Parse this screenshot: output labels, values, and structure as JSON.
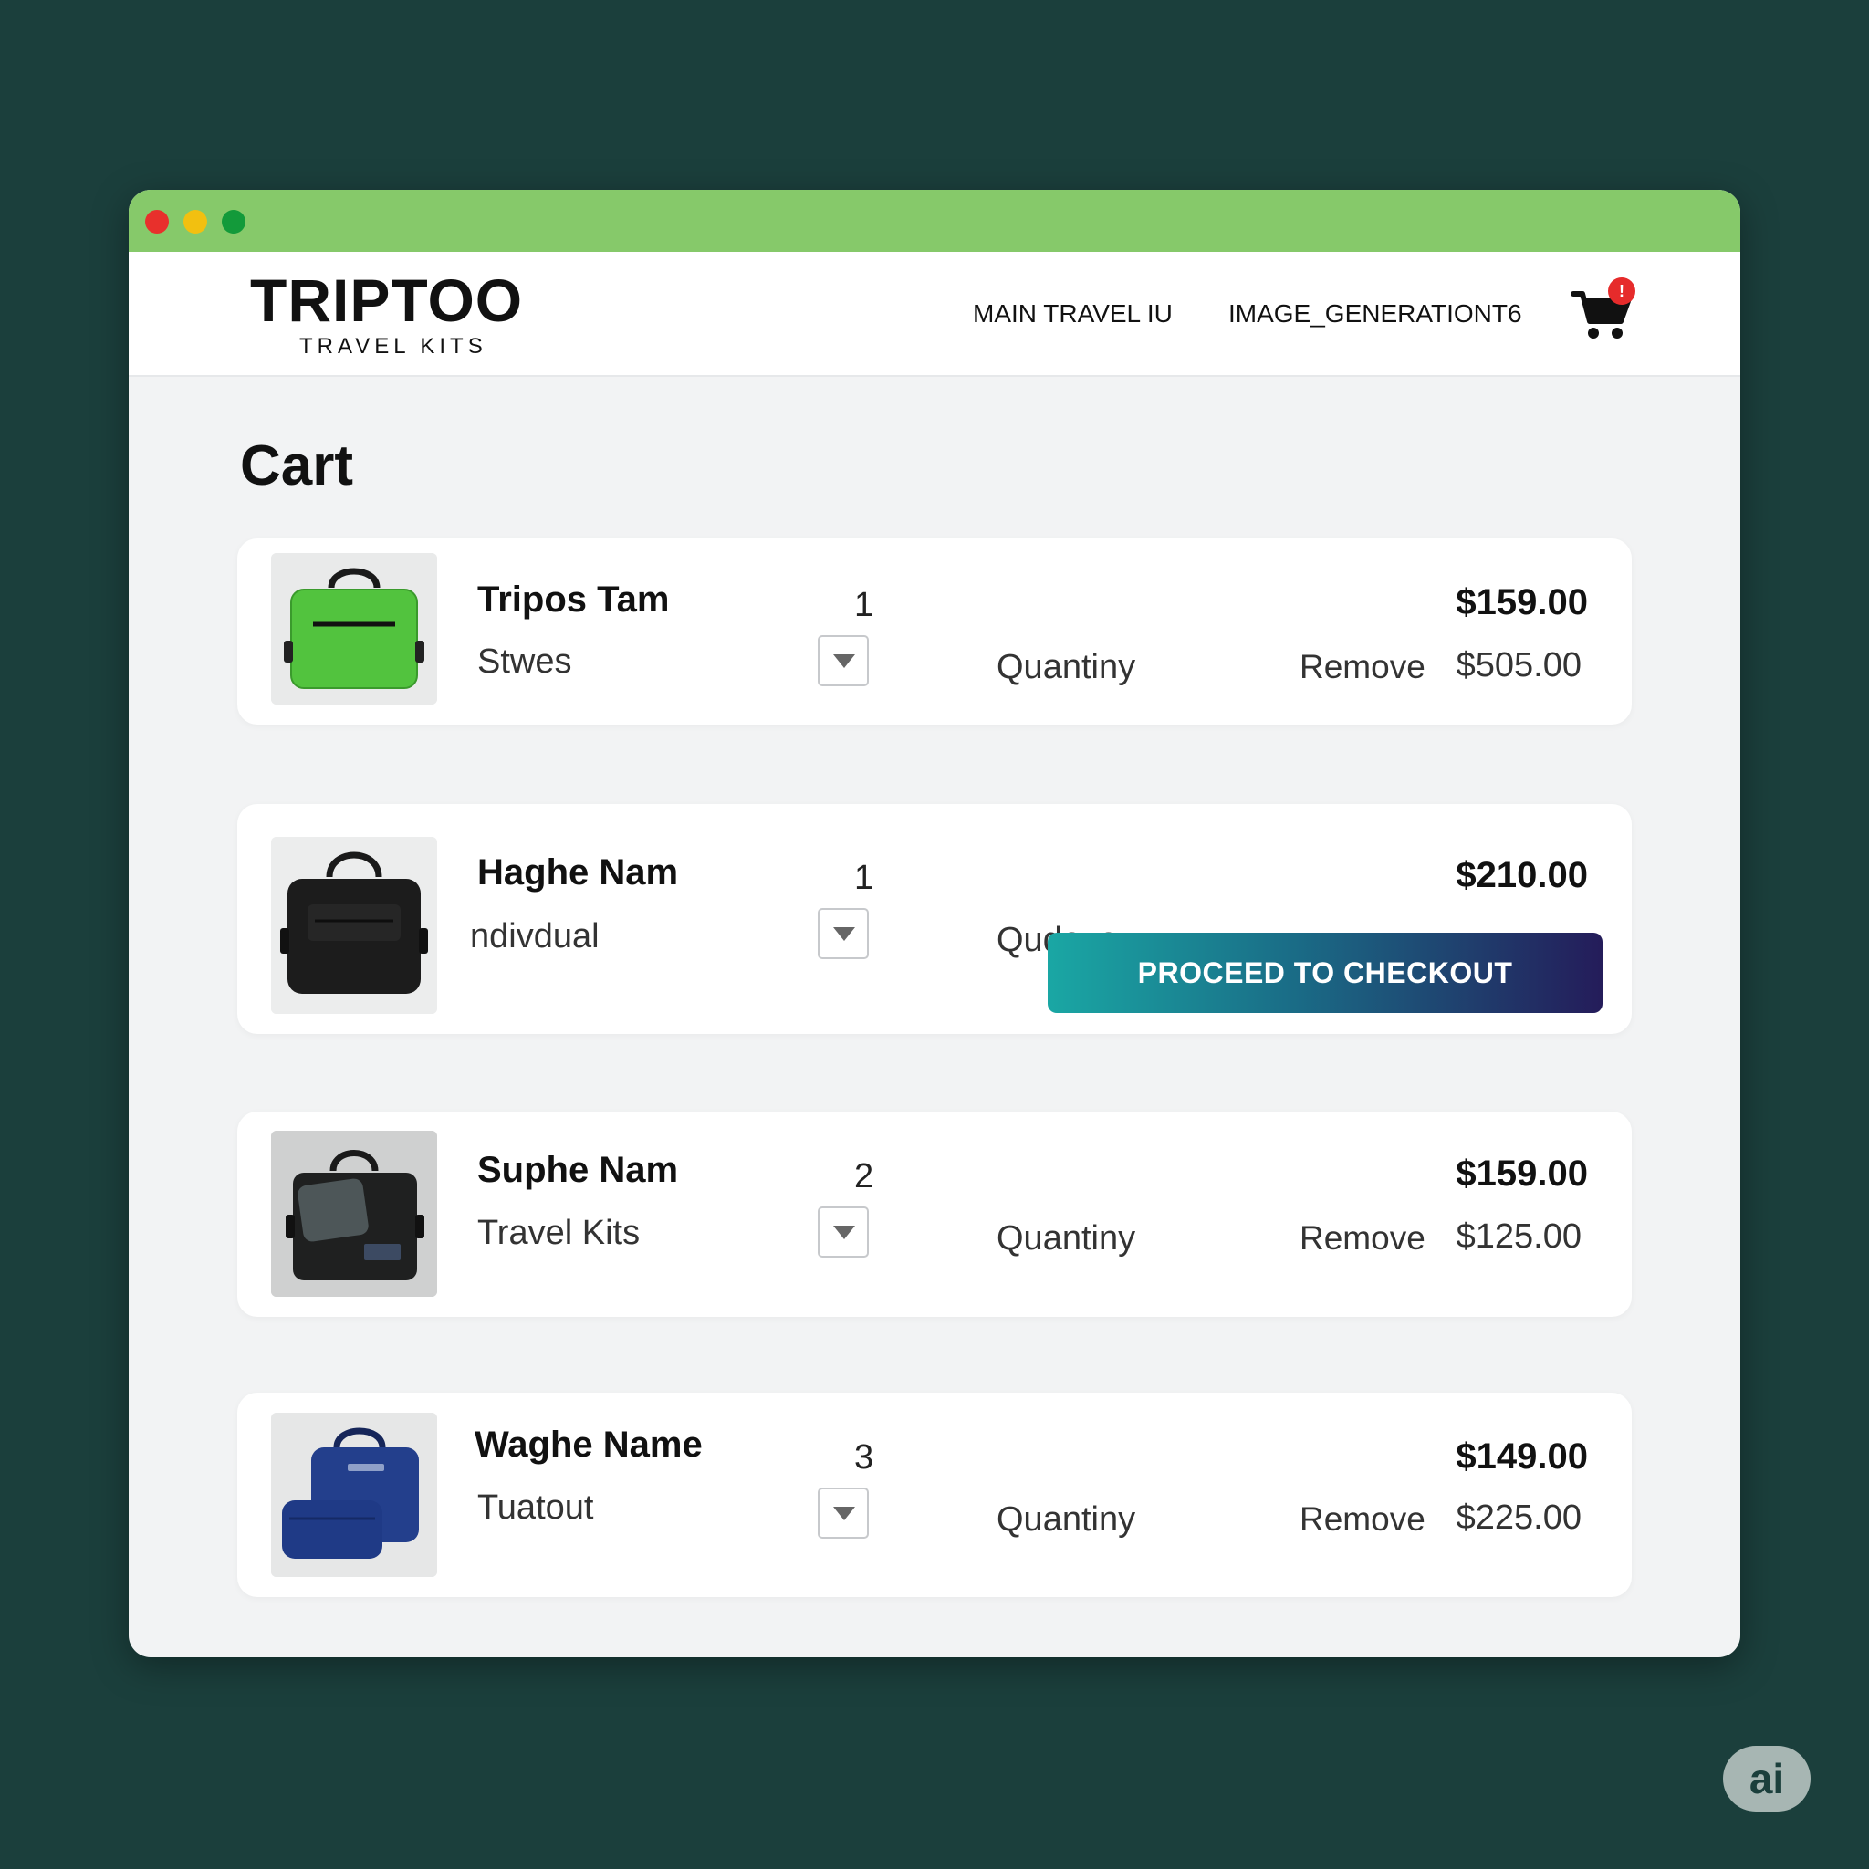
{
  "brand": {
    "name": "TRIPTOO",
    "tagline": "TRAVEL KITS"
  },
  "nav": [
    {
      "label": "MAIN TRAVEL IU"
    },
    {
      "label": "IMAGE_GENERATIONT6"
    }
  ],
  "cart": {
    "badge_count": "!"
  },
  "page": {
    "title": "Cart"
  },
  "items": [
    {
      "name": "Tripos Tam",
      "subtitle": "Stwes",
      "quantity": "1",
      "quantity_label": "Quantiny",
      "remove_label": "Remove",
      "price": "$159.00",
      "subtotal": "$505.00",
      "image_icon": "green-bag-icon"
    },
    {
      "name": "Haghe Nam",
      "subtitle": "ndivdual",
      "quantity": "1",
      "quantity_label": "Qudove",
      "price": "$210.00",
      "image_icon": "black-bag-icon"
    },
    {
      "name": "Suphe Nam",
      "subtitle": "Travel Kits",
      "quantity": "2",
      "quantity_label": "Quantiny",
      "remove_label": "Remove",
      "price": "$159.00",
      "subtotal": "$125.00",
      "image_icon": "black-bag-with-pouch-icon"
    },
    {
      "name": "Waghe Name",
      "subtitle": "Tuatout",
      "quantity": "3",
      "quantity_label": "Quantiny",
      "remove_label": "Remove",
      "price": "$149.00",
      "subtotal": "$225.00",
      "image_icon": "blue-bag-icon"
    }
  ],
  "checkout": {
    "label": "PROCEED TO CHECKOUT"
  },
  "watermark": {
    "label": "ai"
  },
  "colors": {
    "background": "#1b3f3c",
    "titlebar": "#86c96a",
    "checkout_gradient_start": "#1aa7a4",
    "checkout_gradient_end": "#241c5a",
    "badge": "#e62b2b"
  }
}
